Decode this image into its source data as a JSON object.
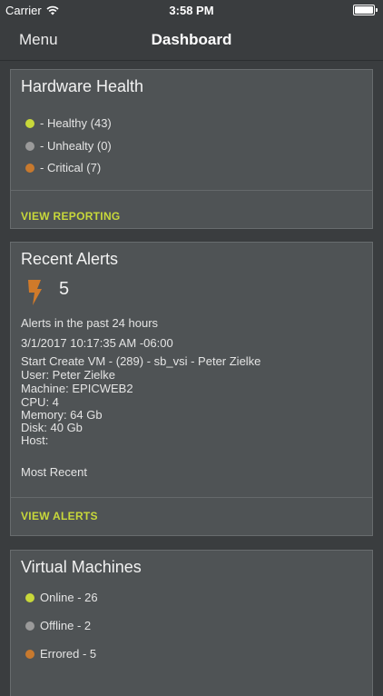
{
  "status_bar": {
    "carrier": "Carrier",
    "time": "3:58 PM"
  },
  "nav": {
    "menu_label": "Menu",
    "title": "Dashboard"
  },
  "colors": {
    "healthy": "#c8d83a",
    "unhealthy": "#9a9a9a",
    "critical": "#c7792e",
    "accent": "#c8d83a"
  },
  "hardware_health": {
    "title": "Hardware Health",
    "items": [
      {
        "label": "- Healthy (43)",
        "status": "healthy"
      },
      {
        "label": "- Unhealty (0)",
        "status": "unhealthy"
      },
      {
        "label": "- Critical (7)",
        "status": "critical"
      }
    ],
    "link_label": "VIEW REPORTING"
  },
  "recent_alerts": {
    "title": "Recent Alerts",
    "icon": "lightning-icon",
    "count": "5",
    "period_label": "Alerts in the past 24 hours",
    "timestamp": "3/1/2017 10:17:35 AM -06:00",
    "details": [
      "Start Create VM - (289) - sb_vsi - Peter Zielke",
      "User: Peter Zielke",
      "Machine: EPICWEB2",
      "CPU: 4",
      "Memory: 64 Gb",
      "Disk: 40 Gb",
      "Host:"
    ],
    "footer_label": "Most Recent",
    "link_label": "VIEW ALERTS"
  },
  "virtual_machines": {
    "title": "Virtual Machines",
    "items": [
      {
        "label": "Online - 26",
        "status": "healthy"
      },
      {
        "label": "Offline - 2",
        "status": "unhealthy"
      },
      {
        "label": "Errored - 5",
        "status": "critical"
      }
    ]
  }
}
